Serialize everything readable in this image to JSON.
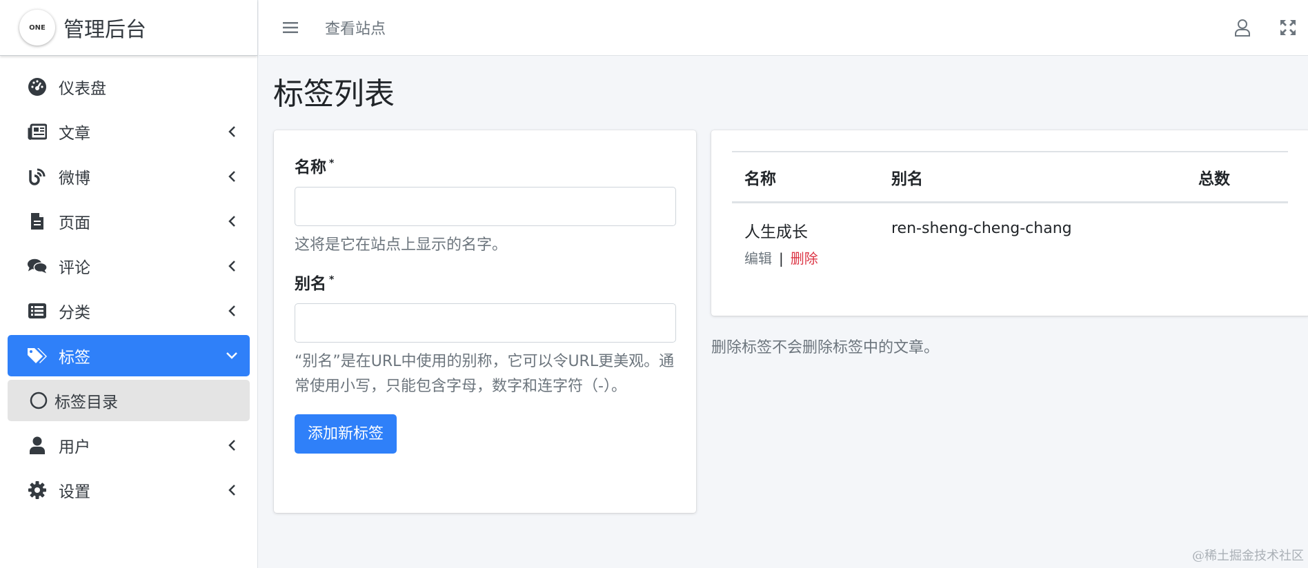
{
  "brand": {
    "logo_text": "ONE",
    "title": "管理后台"
  },
  "sidebar": {
    "items": [
      {
        "label": "仪表盘",
        "icon": "dashboard-icon",
        "has_chevron": false
      },
      {
        "label": "文章",
        "icon": "newspaper-icon",
        "has_chevron": true
      },
      {
        "label": "微博",
        "icon": "blog-icon",
        "has_chevron": true
      },
      {
        "label": "页面",
        "icon": "file-icon",
        "has_chevron": true
      },
      {
        "label": "评论",
        "icon": "comments-icon",
        "has_chevron": true
      },
      {
        "label": "分类",
        "icon": "list-icon",
        "has_chevron": true
      },
      {
        "label": "标签",
        "icon": "tags-icon",
        "has_chevron": true,
        "active": true
      },
      {
        "label": "标签目录",
        "icon": "circle-icon",
        "sub": true
      },
      {
        "label": "用户",
        "icon": "user-icon",
        "has_chevron": true
      },
      {
        "label": "设置",
        "icon": "gear-icon",
        "has_chevron": true
      }
    ]
  },
  "topbar": {
    "view_site": "查看站点"
  },
  "page": {
    "title": "标签列表"
  },
  "form": {
    "name_label": "名称",
    "required_mark": "*",
    "name_help": "这将是它在站点上显示的名字。",
    "slug_label": "别名",
    "slug_help": "“别名”是在URL中使用的别称，它可以令URL更美观。通常使用小写，只能包含字母，数字和连字符（-）。",
    "submit": "添加新标签"
  },
  "table": {
    "headers": [
      "名称",
      "别名",
      "总数"
    ],
    "rows": [
      {
        "name": "人生成长",
        "slug": "ren-sheng-cheng-chang",
        "count": "",
        "edit": "编辑",
        "sep": "|",
        "delete": "删除"
      }
    ]
  },
  "note": "删除标签不会删除标签中的文章。",
  "watermark": "@稀土掘金技术社区",
  "colors": {
    "primary": "#2f80f9",
    "danger": "#dc3545",
    "muted": "#6c757d",
    "bg": "#f4f6f9"
  }
}
